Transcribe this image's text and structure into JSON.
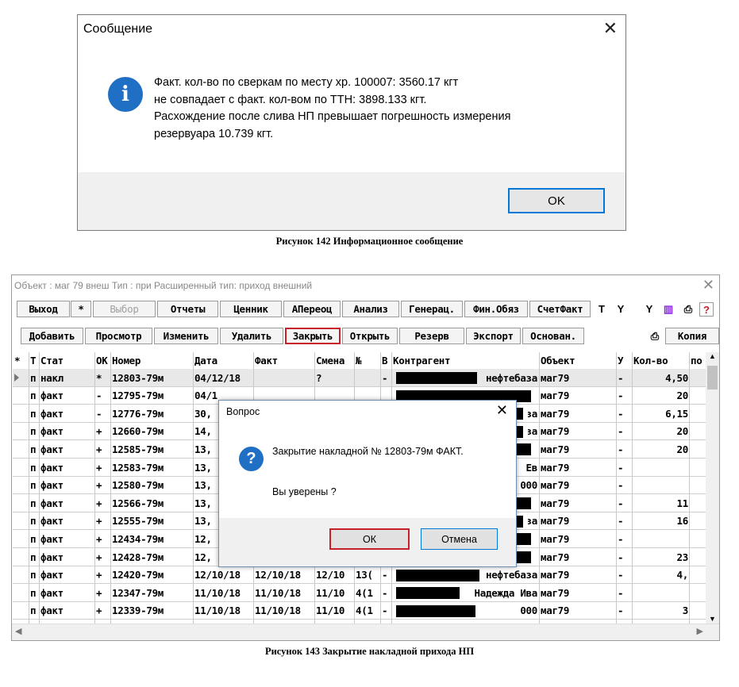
{
  "message_box": {
    "title": "Сообщение",
    "close": "✕",
    "icon": "info-icon",
    "lines": [
      "Факт. кол-во по сверкам по месту хр. 100007: 3560.17 кгт",
      "не совпадает с факт. кол-вом по ТТН: 3898.133 кгт.",
      "Расхождение после слива НП превышает погрешность измерения",
      "резервуара 10.739 кгт."
    ],
    "ok_label": "OK"
  },
  "caption1": "Рисунок 142 Информационное сообщение",
  "caption2": "Рисунок 143 Закрытие накладной прихода НП",
  "main_window": {
    "title": "Объект : маг 79  внеш   Тип : при Расширенный тип: приход внешний",
    "close": "✕",
    "toolbar1": [
      "Выход",
      "Выбор",
      "Отчеты",
      "Ценник",
      "АПереоц",
      "Анализ",
      "Генерац.",
      "Фин.Обяз",
      "СчетФакт"
    ],
    "toolbar1_star": "*",
    "toolbar2": [
      "Добавить",
      "Просмотр",
      "Изменить",
      "Удалить",
      "Закрыть",
      "Открыть",
      "Резерв",
      "Экспорт",
      "Основан."
    ],
    "copy_label": "Копия",
    "highlight_color": "#c8202a",
    "columns": [
      "*",
      "Т",
      "Стат",
      "ОК",
      "Номер",
      "Дата",
      "Факт",
      "Смена",
      "№",
      "В",
      "Контрагент",
      "Объект",
      "У",
      "Кол-во",
      "по"
    ],
    "rows": [
      {
        "t": "п",
        "stat": "накл",
        "ok": "*",
        "num": "12803-79м",
        "date": "04/12/18",
        "fact": "",
        "shift": "?",
        "no": "",
        "v": "-",
        "agent": "нефтебаза",
        "obj": "маг79",
        "u": "-",
        "qty": "4,50"
      },
      {
        "t": "п",
        "stat": "факт",
        "ok": "-",
        "num": "12795-79м",
        "date": "04/1",
        "fact": "",
        "shift": "",
        "no": "",
        "v": "",
        "agent": "",
        "obj": "маг79",
        "u": "-",
        "qty": "20"
      },
      {
        "t": "п",
        "stat": "факт",
        "ok": "-",
        "num": "12776-79м",
        "date": "30,",
        "fact": "",
        "shift": "",
        "no": "",
        "v": "",
        "agent": "за",
        "obj": "маг79",
        "u": "-",
        "qty": "6,15"
      },
      {
        "t": "п",
        "stat": "факт",
        "ok": "+",
        "num": "12660-79м",
        "date": "14,",
        "fact": "",
        "shift": "",
        "no": "",
        "v": "",
        "agent": "за",
        "obj": "маг79",
        "u": "-",
        "qty": "20"
      },
      {
        "t": "п",
        "stat": "факт",
        "ok": "+",
        "num": "12585-79м",
        "date": "13,",
        "fact": "",
        "shift": "",
        "no": "",
        "v": "",
        "agent": "",
        "obj": "маг79",
        "u": "-",
        "qty": "20"
      },
      {
        "t": "п",
        "stat": "факт",
        "ok": "+",
        "num": "12583-79м",
        "date": "13,",
        "fact": "",
        "shift": "",
        "no": "",
        "v": "",
        "agent": "Ев",
        "obj": "маг79",
        "u": "-",
        "qty": ""
      },
      {
        "t": "п",
        "stat": "факт",
        "ok": "+",
        "num": "12580-79м",
        "date": "13,",
        "fact": "",
        "shift": "",
        "no": "",
        "v": "",
        "agent": "000",
        "obj": "маг79",
        "u": "-",
        "qty": ""
      },
      {
        "t": "п",
        "stat": "факт",
        "ok": "+",
        "num": "12566-79м",
        "date": "13,",
        "fact": "",
        "shift": "",
        "no": "",
        "v": "",
        "agent": "",
        "obj": "маг79",
        "u": "-",
        "qty": "11"
      },
      {
        "t": "п",
        "stat": "факт",
        "ok": "+",
        "num": "12555-79м",
        "date": "13,",
        "fact": "",
        "shift": "",
        "no": "",
        "v": "",
        "agent": "за",
        "obj": "маг79",
        "u": "-",
        "qty": "16"
      },
      {
        "t": "п",
        "stat": "факт",
        "ok": "+",
        "num": "12434-79м",
        "date": "12,",
        "fact": "",
        "shift": "",
        "no": "",
        "v": "",
        "agent": "",
        "obj": "маг79",
        "u": "-",
        "qty": ""
      },
      {
        "t": "п",
        "stat": "факт",
        "ok": "+",
        "num": "12428-79м",
        "date": "12,",
        "fact": "",
        "shift": "",
        "no": "",
        "v": "",
        "agent": "",
        "obj": "маг79",
        "u": "-",
        "qty": "23"
      },
      {
        "t": "п",
        "stat": "факт",
        "ok": "+",
        "num": "12420-79м",
        "date": "12/10/18",
        "fact": "12/10/18",
        "shift": "12/10",
        "no": "13(",
        "v": "-",
        "agent": "нефтебаза",
        "obj": "маг79",
        "u": "-",
        "qty": "4,"
      },
      {
        "t": "п",
        "stat": "факт",
        "ok": "+",
        "num": "12347-79м",
        "date": "11/10/18",
        "fact": "11/10/18",
        "shift": "11/10",
        "no": "4(1",
        "v": "-",
        "agent": "Надежда Ива",
        "obj": "маг79",
        "u": "-",
        "qty": ""
      },
      {
        "t": "п",
        "stat": "факт",
        "ok": "+",
        "num": "12339-79м",
        "date": "11/10/18",
        "fact": "11/10/18",
        "shift": "11/10",
        "no": "4(1",
        "v": "-",
        "agent": "000",
        "obj": "маг79",
        "u": "-",
        "qty": "3"
      }
    ]
  },
  "dialog": {
    "title": "Вопрос",
    "close": "✕",
    "icon": "question-icon",
    "line1": "Закрытие накладной №  12803-79м ФАКТ.",
    "line2": "Вы уверены ?",
    "ok_label": "ОК",
    "cancel_label": "Отмена"
  }
}
